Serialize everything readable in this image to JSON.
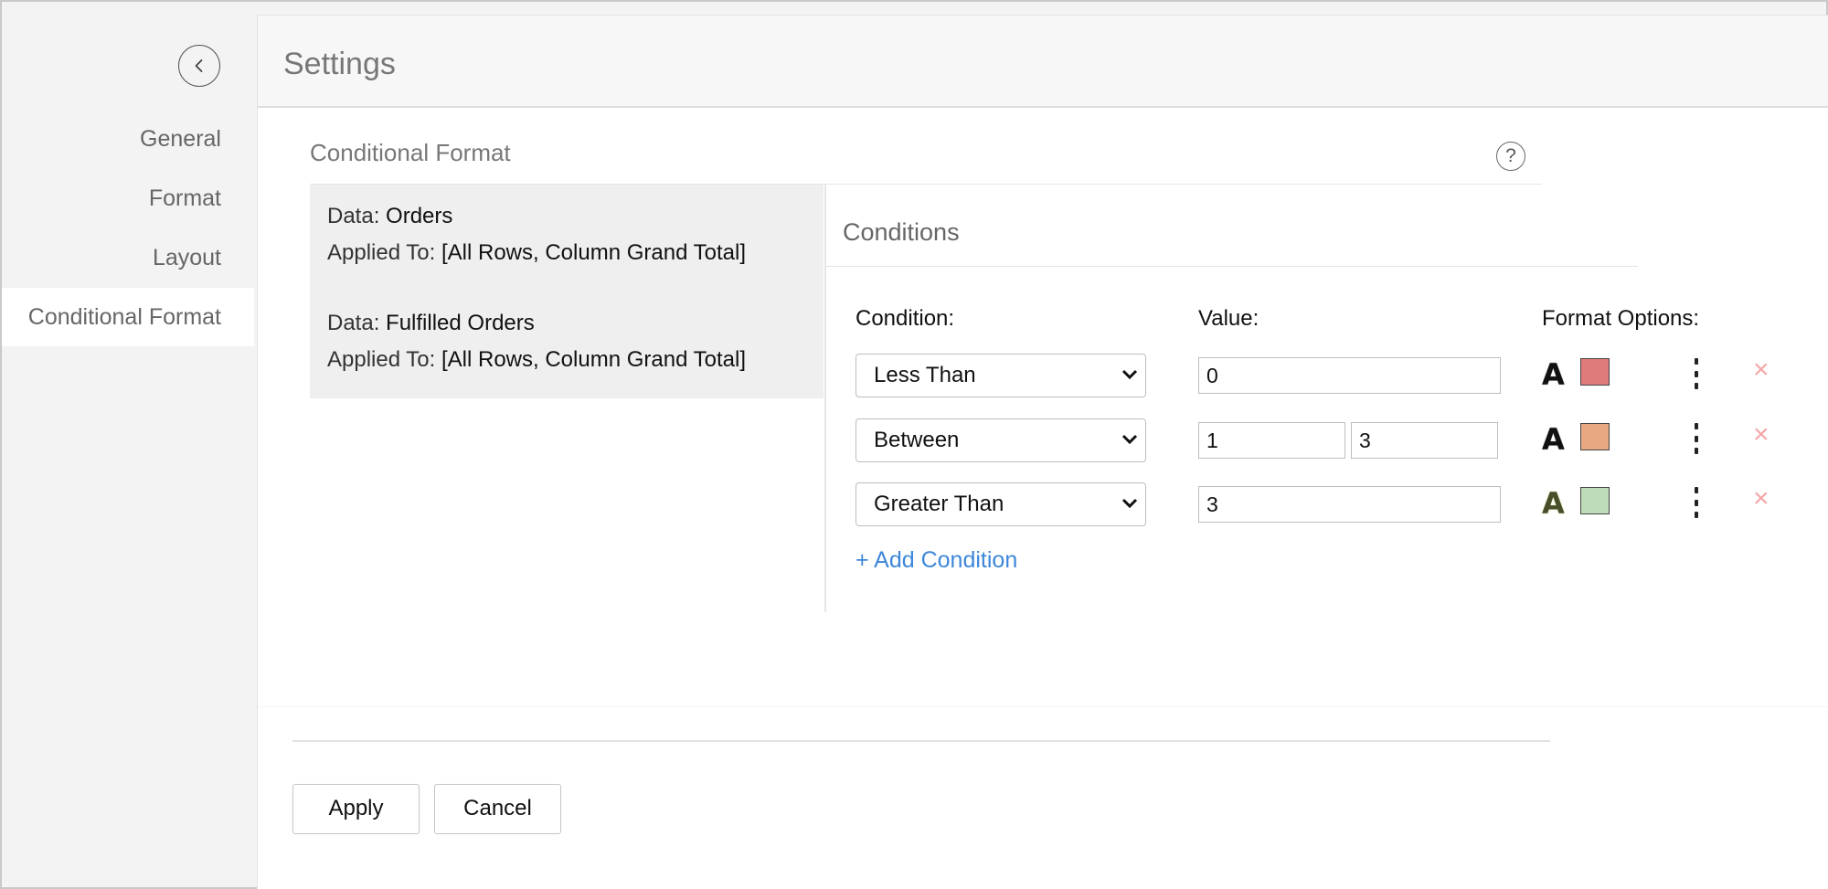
{
  "sidebar": {
    "items": [
      {
        "label": "General"
      },
      {
        "label": "Format"
      },
      {
        "label": "Layout"
      },
      {
        "label": "Conditional Format"
      }
    ]
  },
  "header": {
    "title": "Settings"
  },
  "section": {
    "title": "Conditional Format"
  },
  "data_list": [
    {
      "data_key": "Data:",
      "data_value": "Orders",
      "applied_key": "Applied To:",
      "applied_value": "[All Rows, Column Grand Total]"
    },
    {
      "data_key": "Data:",
      "data_value": "Fulfilled Orders",
      "applied_key": "Applied To:",
      "applied_value": "[All Rows, Column Grand Total]"
    }
  ],
  "conditions": {
    "title": "Conditions",
    "labels": {
      "condition": "Condition:",
      "value": "Value:",
      "format": "Format Options:"
    },
    "rows": [
      {
        "condition": "Less Than",
        "values": [
          "0"
        ],
        "font_icon": "A",
        "font_color": "#111111",
        "fill_color": "#e07b7b"
      },
      {
        "condition": "Between",
        "values": [
          "1",
          "3"
        ],
        "font_icon": "A",
        "font_color": "#111111",
        "fill_color": "#e8a882"
      },
      {
        "condition": "Greater Than",
        "values": [
          "3"
        ],
        "font_icon": "A",
        "font_color": "#4a4d2a",
        "fill_color": "#bfdcb8"
      }
    ],
    "remove_icon": "×",
    "add_label": "+ Add Condition"
  },
  "footer": {
    "apply_label": "Apply",
    "cancel_label": "Cancel"
  },
  "help_icon": "?"
}
